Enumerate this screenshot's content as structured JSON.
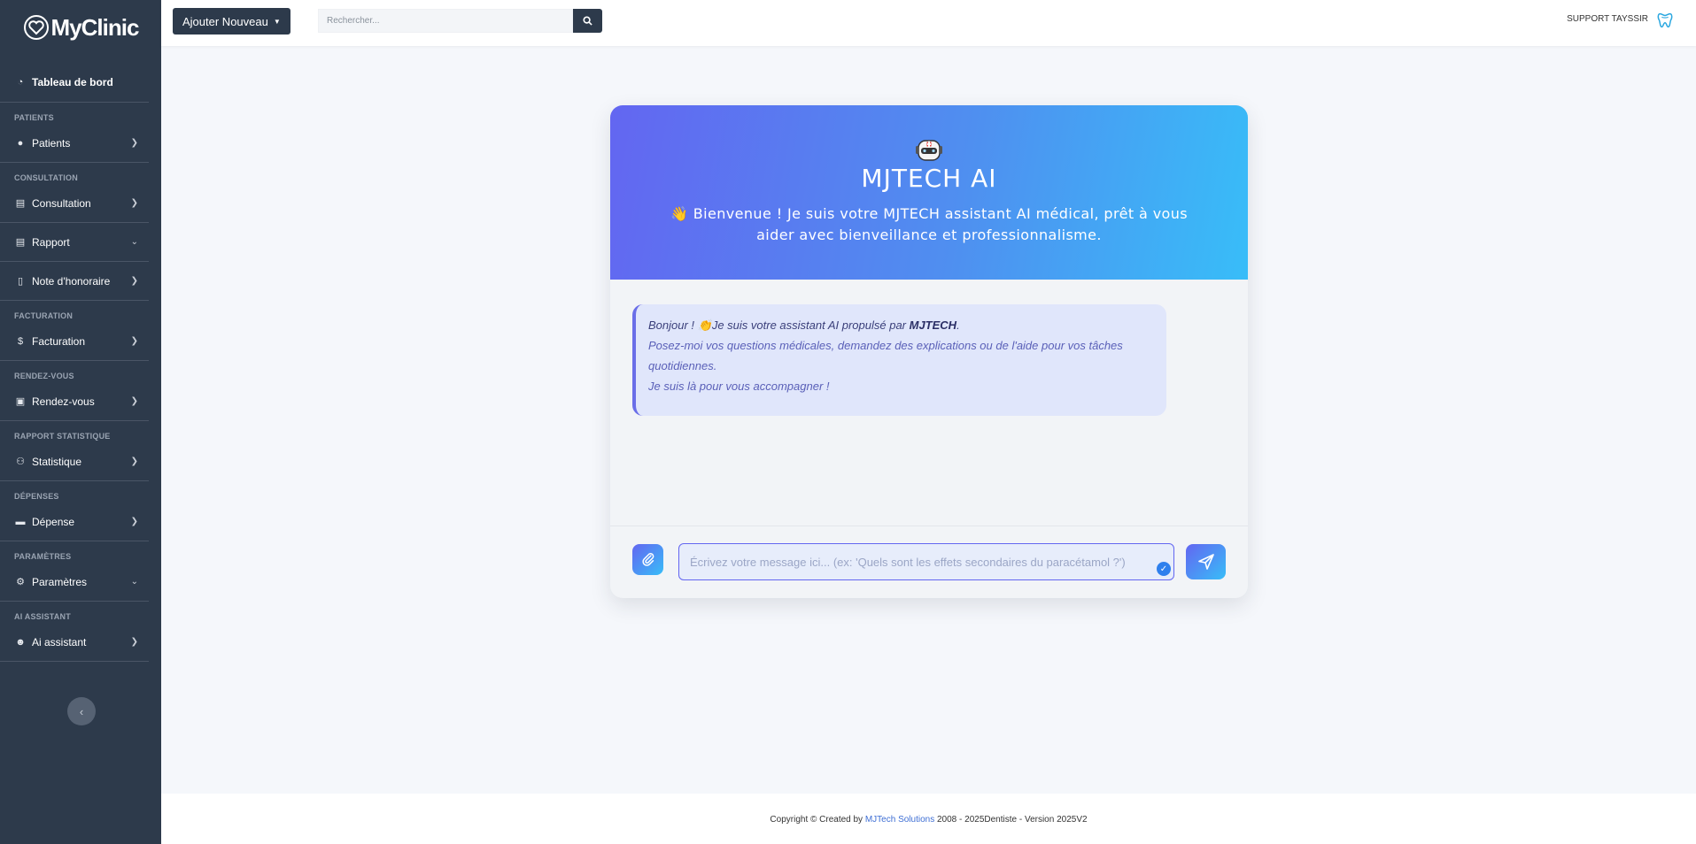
{
  "brand": {
    "my": "My",
    "clinic": "Clinic"
  },
  "sidebar": {
    "dashboard": "Tableau de bord",
    "sections": {
      "patients": "PATIENTS",
      "consultation": "CONSULTATION",
      "facturation": "FACTURATION",
      "rendezvous": "RENDEZ-VOUS",
      "rapport_stat": "RAPPORT STATISTIQUE",
      "depenses": "DÉPENSES",
      "parametres": "PARAMÈTRES",
      "ai": "AI ASSISTANT"
    },
    "items": {
      "patients": "Patients",
      "consultation": "Consultation",
      "rapport": "Rapport",
      "note": "Note d'honoraire",
      "facturation": "Facturation",
      "rendezvous": "Rendez-vous",
      "statistique": "Statistique",
      "depense": "Dépense",
      "parametres": "Paramètres",
      "ai_assistant": "Ai assistant"
    }
  },
  "topbar": {
    "add_label": "Ajouter Nouveau",
    "search_placeholder": "Rechercher...",
    "user": "SUPPORT TAYSSIR"
  },
  "chat": {
    "title": "MJTECH AI",
    "welcome": "👋 Bienvenue ! Je suis votre MJTECH assistant AI médical, prêt à vous aider avec bienveillance et professionnalisme.",
    "bot_message": {
      "line1_prefix": "Bonjour ! 👏Je suis votre assistant AI propulsé par ",
      "line1_brand": "MJTECH",
      "line1_suffix": ".",
      "line2": "Posez-moi vos questions médicales, demandez des explications ou de l'aide pour vos tâches quotidiennes.",
      "line3": "Je suis là pour vous accompagner !"
    },
    "input_placeholder": "Écrivez votre message ici... (ex: 'Quels sont les effets secondaires du paracétamol ?')"
  },
  "footer": {
    "prefix": "Copyright © Created by ",
    "link": "MJTech Solutions",
    "suffix": " 2008 - 2025Dentiste - Version 2025V2"
  }
}
